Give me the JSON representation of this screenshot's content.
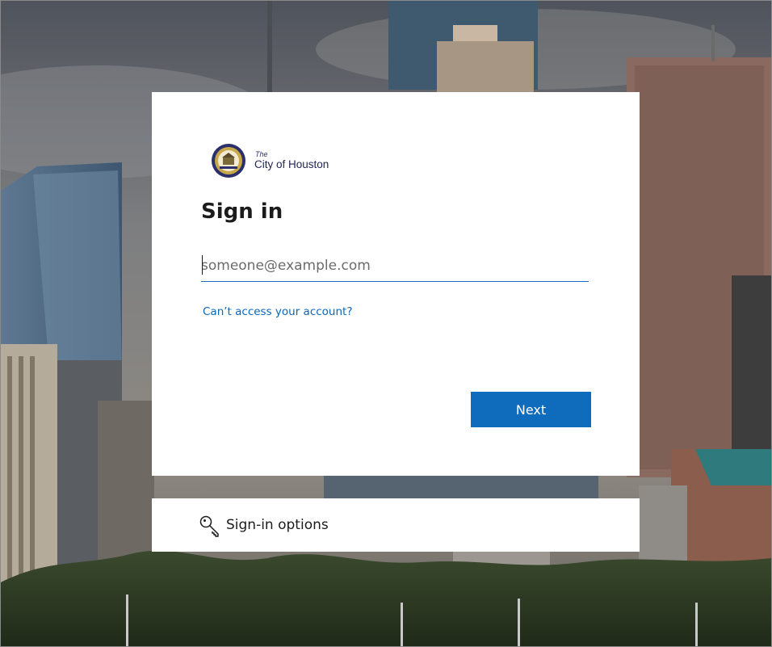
{
  "background": {
    "description_icon": "city-skyline-background"
  },
  "card": {
    "logo": {
      "seal_icon": "city-seal-icon",
      "the": "The",
      "org_name": "City of Houston"
    },
    "title": "Sign in",
    "email": {
      "value": "",
      "placeholder": "someone@example.com"
    },
    "cant_access_link": "Can’t access your account?",
    "next_button": "Next"
  },
  "sign_in_options": {
    "icon": "key-icon",
    "label": "Sign-in options"
  },
  "colors": {
    "accent": "#0f6cbd",
    "link": "#0b67b8",
    "input_underline": "#1a6cc0",
    "text": "#1b1b1b"
  }
}
